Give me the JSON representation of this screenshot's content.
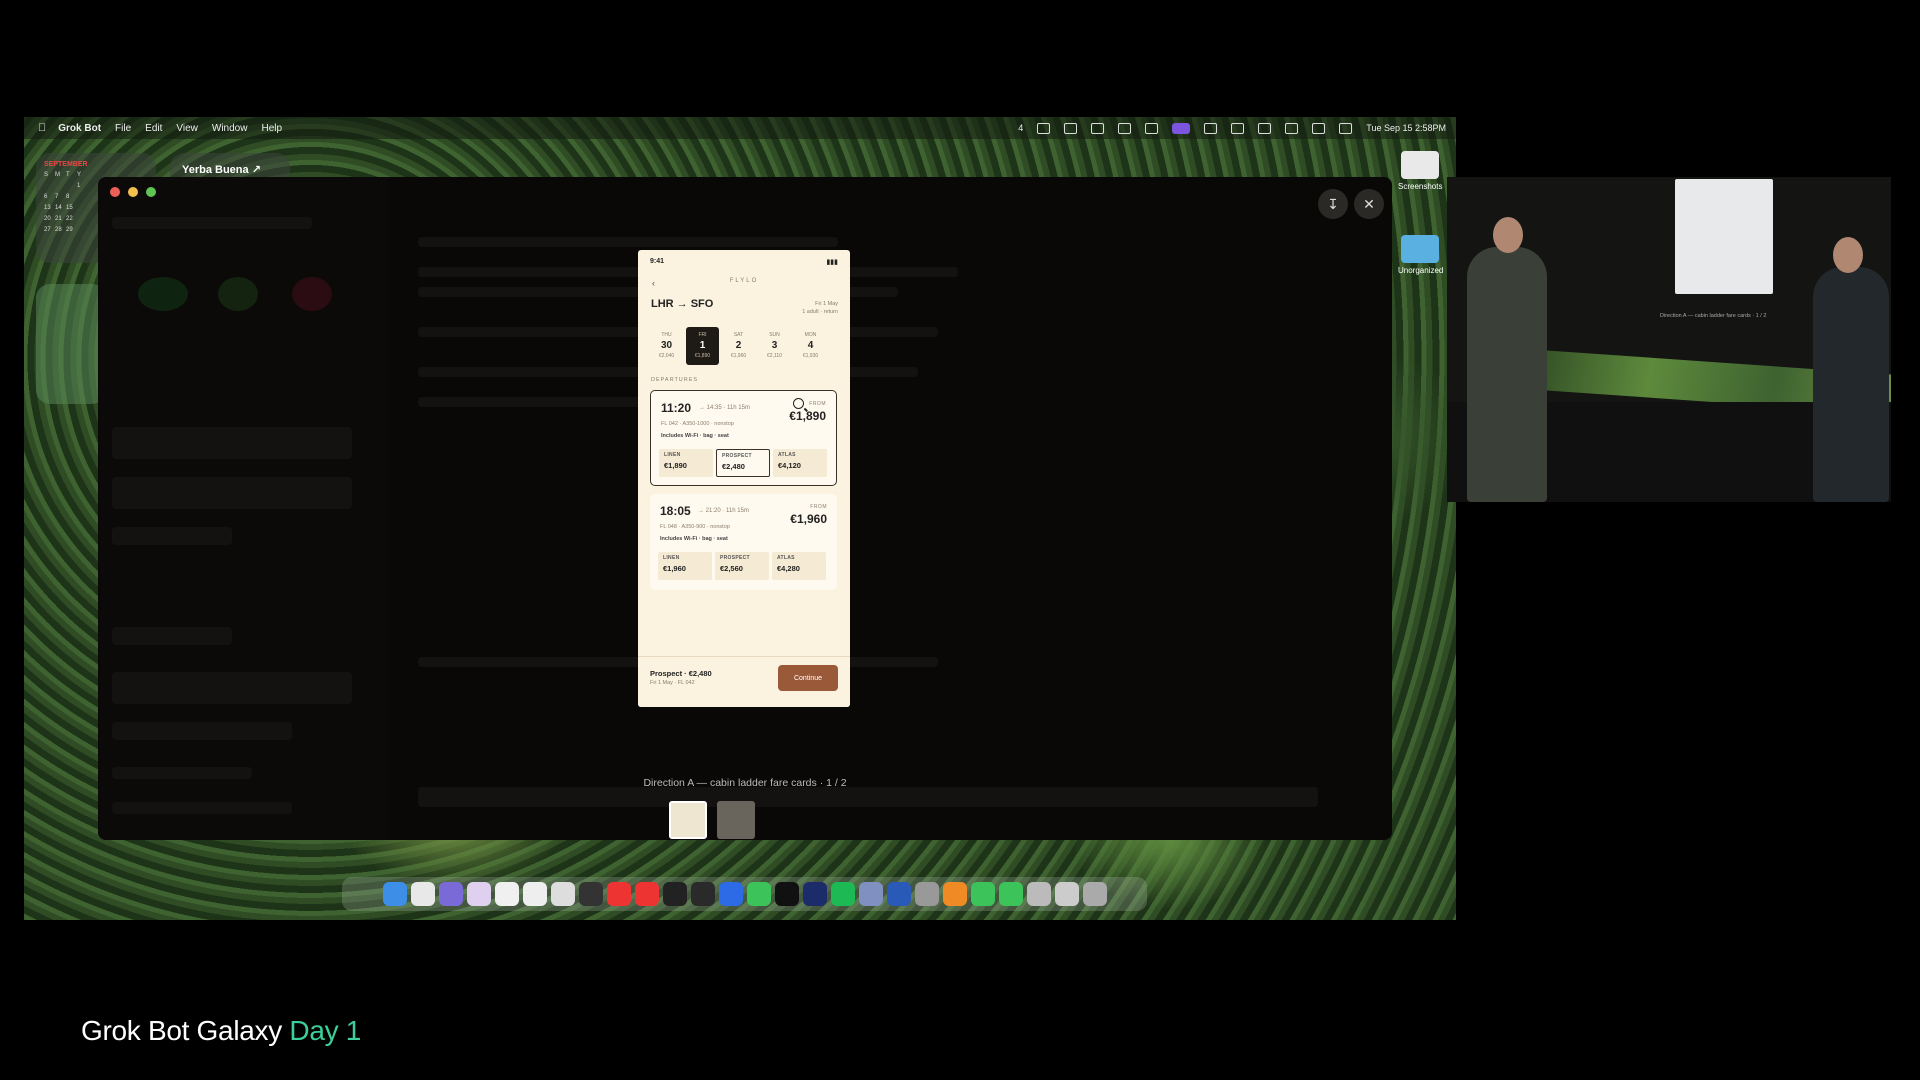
{
  "menubar": {
    "app_name": "Grok Bot",
    "menus": [
      "File",
      "Edit",
      "View",
      "Window",
      "Help"
    ],
    "status_count": "4",
    "clock": "Tue Sep 15  2:58PM"
  },
  "widgets": {
    "calendar_month": "SEPTEMBER",
    "calendar_days": [
      "S",
      "M",
      "T",
      "Y",
      "",
      "",
      "",
      "1",
      "6",
      "7",
      "8",
      "",
      "13",
      "14",
      "15",
      "",
      "20",
      "21",
      "22",
      "",
      "27",
      "28",
      "29",
      ""
    ],
    "weather_city": "Yerba Buena ↗"
  },
  "desktop": {
    "icon_1": "Screenshots",
    "icon_2": "Unorganized"
  },
  "viewer": {
    "caption": "Direction A — cabin ladder fare cards · 1 / 2"
  },
  "phone": {
    "time": "9:41",
    "brand": "FLYLO",
    "route": "LHR → SFO",
    "date_line1": "Fri 1 May",
    "date_line2": "1 adult · return",
    "days": [
      {
        "name": "THU",
        "date": "30",
        "price": "€2,040"
      },
      {
        "name": "FRI",
        "date": "1",
        "price": "€1,890"
      },
      {
        "name": "SAT",
        "date": "2",
        "price": "€1,960"
      },
      {
        "name": "SUN",
        "date": "3",
        "price": "€2,110"
      },
      {
        "name": "MON",
        "date": "4",
        "price": "€1,930"
      }
    ],
    "departures_label": "DEPARTURES",
    "flights": [
      {
        "time": "11:20",
        "arrival": "→ 14:35 · 11h 15m",
        "from_label": "FROM",
        "price": "€1,890",
        "flight": "FL 042 · A350-1000 · nonstop",
        "includes": "Includes Wi-Fi · bag · seat",
        "fares": [
          {
            "name": "LINEN",
            "price": "€1,890"
          },
          {
            "name": "PROSPECT",
            "price": "€2,480"
          },
          {
            "name": "ATLAS",
            "price": "€4,120"
          }
        ]
      },
      {
        "time": "18:05",
        "arrival": "→ 21:20 · 11h 15m",
        "from_label": "FROM",
        "price": "€1,960",
        "flight": "FL 048 · A350-900 · nonstop",
        "includes": "Includes Wi-Fi · bag · seat",
        "fares": [
          {
            "name": "LINEN",
            "price": "€1,960"
          },
          {
            "name": "PROSPECT",
            "price": "€2,560"
          },
          {
            "name": "ATLAS",
            "price": "€4,280"
          }
        ]
      }
    ],
    "selection": "Prospect · €2,480",
    "selection_sub": "Fri 1 May · FL 042",
    "continue_label": "Continue"
  },
  "camera": {
    "screen_caption": "Direction A — cabin ladder fare cards · 1 / 2"
  },
  "event": {
    "title": "Grok Bot Galaxy",
    "day": "Day 1"
  },
  "colors": {
    "accent_green": "#3ccf9a",
    "continue_button": "#9a5a3a",
    "phone_background": "#fbf2df"
  }
}
